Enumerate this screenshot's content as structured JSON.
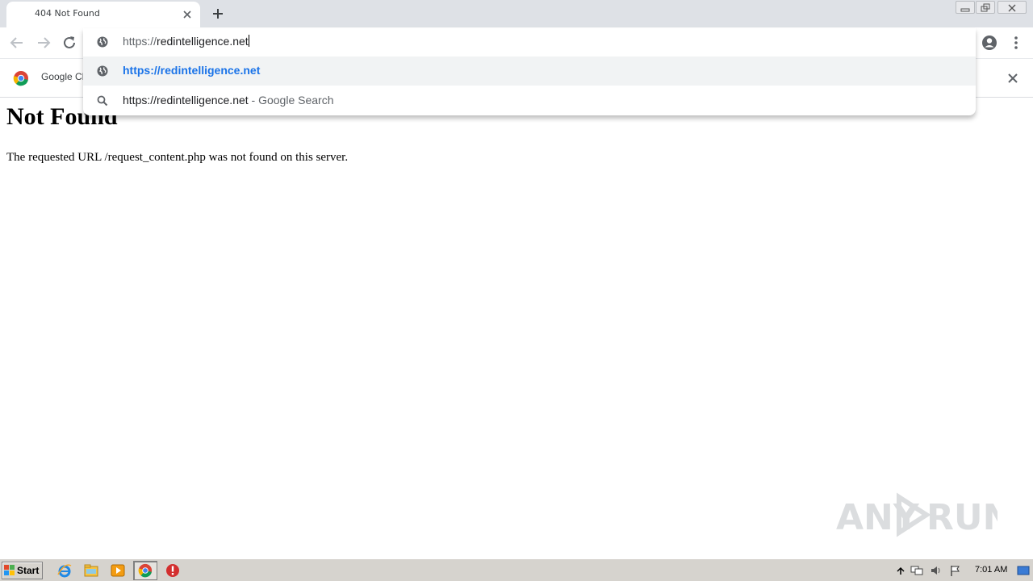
{
  "tab": {
    "title": "404 Not Found"
  },
  "omnibox": {
    "scheme": "https://",
    "host": "redintelligence.net"
  },
  "suggestions": [
    {
      "text": "https://redintelligence.net",
      "hint": ""
    },
    {
      "text": "https://redintelligence.net",
      "hint": " - Google Search"
    }
  ],
  "infobar": {
    "text": "Google Ch"
  },
  "page": {
    "heading": "Not Found",
    "message": "The requested URL /request_content.php was not found on this server."
  },
  "watermark": {
    "left": "ANY",
    "right": "RUN"
  },
  "taskbar": {
    "start_label": "Start",
    "clock": "7:01 AM"
  },
  "colors": {
    "accent": "#1a73e8",
    "tabstrip": "#dee1e6",
    "taskbar": "#d6d3ce"
  }
}
